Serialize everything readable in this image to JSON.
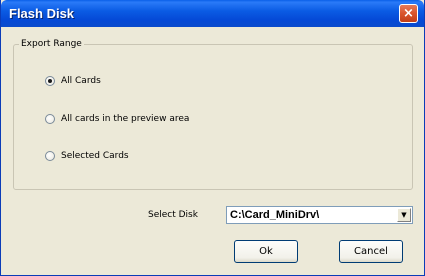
{
  "window": {
    "title": "Flash Disk",
    "close_icon": "×"
  },
  "export_range": {
    "legend": "Export Range",
    "options": [
      {
        "label": "All Cards",
        "checked": true
      },
      {
        "label": "All cards in the preview area",
        "checked": false
      },
      {
        "label": "Selected Cards",
        "checked": false
      }
    ]
  },
  "select_disk": {
    "label": "Select Disk",
    "value": "C:\\Card_MiniDrv\\",
    "arrow": "▼"
  },
  "buttons": {
    "ok": "Ok",
    "cancel": "Cancel"
  }
}
